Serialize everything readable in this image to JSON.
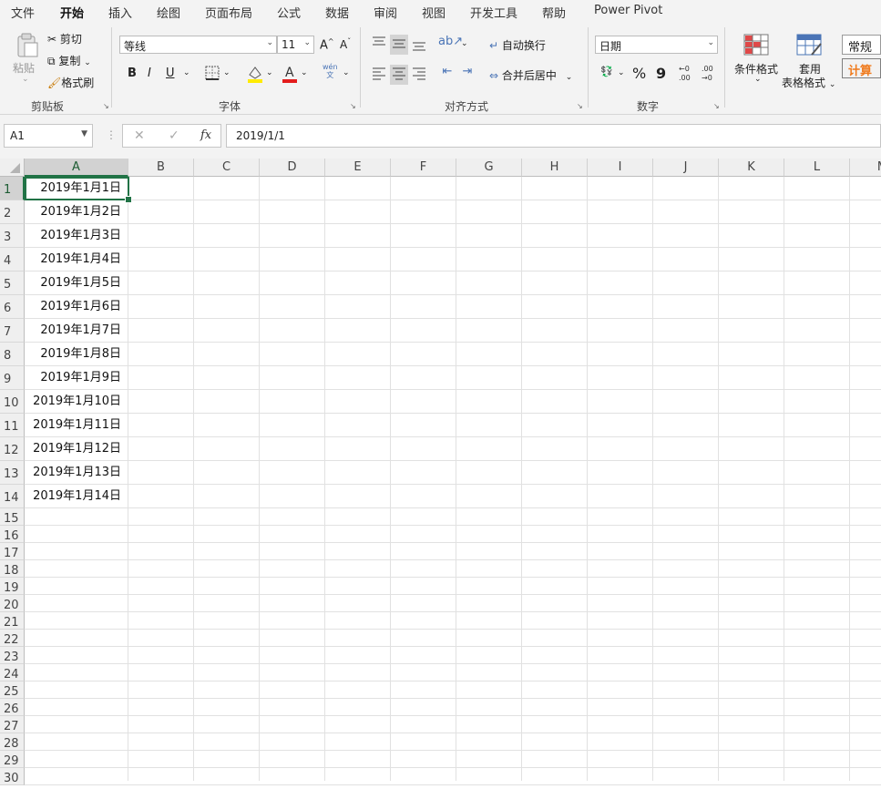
{
  "tabs": [
    "文件",
    "开始",
    "插入",
    "绘图",
    "页面布局",
    "公式",
    "数据",
    "审阅",
    "视图",
    "开发工具",
    "帮助",
    "Power Pivot"
  ],
  "clipboard": {
    "paste": "粘贴",
    "cut": "剪切",
    "copy": "复制",
    "format_painter": "格式刷",
    "label": "剪贴板"
  },
  "font": {
    "name": "等线",
    "size": "11",
    "grow": "A",
    "shrink": "A",
    "bold": "B",
    "italic": "I",
    "underline": "U",
    "phonetic": "wén\n文",
    "label": "字体"
  },
  "alignment": {
    "wrap": "自动换行",
    "merge": "合并后居中",
    "label": "对齐方式"
  },
  "number": {
    "format": "日期",
    "percent": "%",
    "comma": "9",
    "inc_decimal": "←0\n.00",
    "dec_decimal": ".00\n→0",
    "label": "数字"
  },
  "styles": {
    "conditional": "条件格式",
    "table_line1": "套用",
    "table_line2": "表格格式",
    "normal": "常规",
    "calc": "计算"
  },
  "formula_bar": {
    "namebox": "A1",
    "cancel": "✕",
    "enter": "✓",
    "fx": "fx",
    "formula": "2019/1/1"
  },
  "columns": [
    "A",
    "B",
    "C",
    "D",
    "E",
    "F",
    "G",
    "H",
    "I",
    "J",
    "K",
    "L",
    "M"
  ],
  "rows": [
    "1",
    "2",
    "3",
    "4",
    "5",
    "6",
    "7",
    "8",
    "9",
    "10",
    "11",
    "12",
    "13",
    "14",
    "15",
    "16",
    "17",
    "18",
    "19",
    "20",
    "21",
    "22",
    "23",
    "24",
    "25",
    "26",
    "27",
    "28",
    "29",
    "30"
  ],
  "cells_A": [
    "2019年1月1日",
    "2019年1月2日",
    "2019年1月3日",
    "2019年1月4日",
    "2019年1月5日",
    "2019年1月6日",
    "2019年1月7日",
    "2019年1月8日",
    "2019年1月9日",
    "2019年1月10日",
    "2019年1月11日",
    "2019年1月12日",
    "2019年1月13日",
    "2019年1月14日"
  ],
  "colors": {
    "accent": "#217346",
    "font_color": "#e31c1c",
    "highlight": "#ffeb00",
    "calc_text": "#f07a1c"
  }
}
